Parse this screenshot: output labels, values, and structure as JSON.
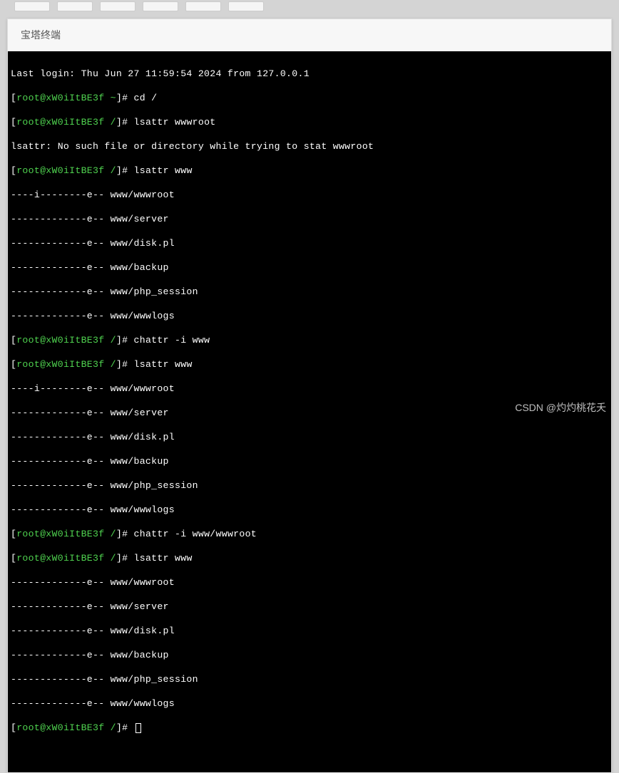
{
  "window": {
    "title": "宝塔终端"
  },
  "terminal": {
    "login_line": "Last login: Thu Jun 27 11:59:54 2024 from 127.0.0.1",
    "user": "root",
    "host": "xW0iItBE3f",
    "prompts": {
      "p1": {
        "path": "~",
        "cmd": "cd /"
      },
      "p2": {
        "path": "/",
        "cmd": "lsattr wwwroot"
      },
      "err2": "lsattr: No such file or directory while trying to stat wwwroot",
      "p3": {
        "path": "/",
        "cmd": "lsattr www"
      },
      "out3": [
        "----i--------e-- www/wwwroot",
        "-------------e-- www/server",
        "-------------e-- www/disk.pl",
        "-------------e-- www/backup",
        "-------------e-- www/php_session",
        "-------------e-- www/wwwlogs"
      ],
      "p4": {
        "path": "/",
        "cmd": "chattr -i www"
      },
      "p5": {
        "path": "/",
        "cmd": "lsattr www"
      },
      "out5": [
        "----i--------e-- www/wwwroot",
        "-------------e-- www/server",
        "-------------e-- www/disk.pl",
        "-------------e-- www/backup",
        "-------------e-- www/php_session",
        "-------------e-- www/wwwlogs"
      ],
      "p6": {
        "path": "/",
        "cmd": "chattr -i www/wwwroot"
      },
      "p7": {
        "path": "/",
        "cmd": "lsattr www"
      },
      "out7": [
        "-------------e-- www/wwwroot",
        "-------------e-- www/server",
        "-------------e-- www/disk.pl",
        "-------------e-- www/backup",
        "-------------e-- www/php_session",
        "-------------e-- www/wwwlogs"
      ],
      "p8": {
        "path": "/",
        "cmd": ""
      }
    }
  },
  "watermark": "CSDN @灼灼桃花夭"
}
